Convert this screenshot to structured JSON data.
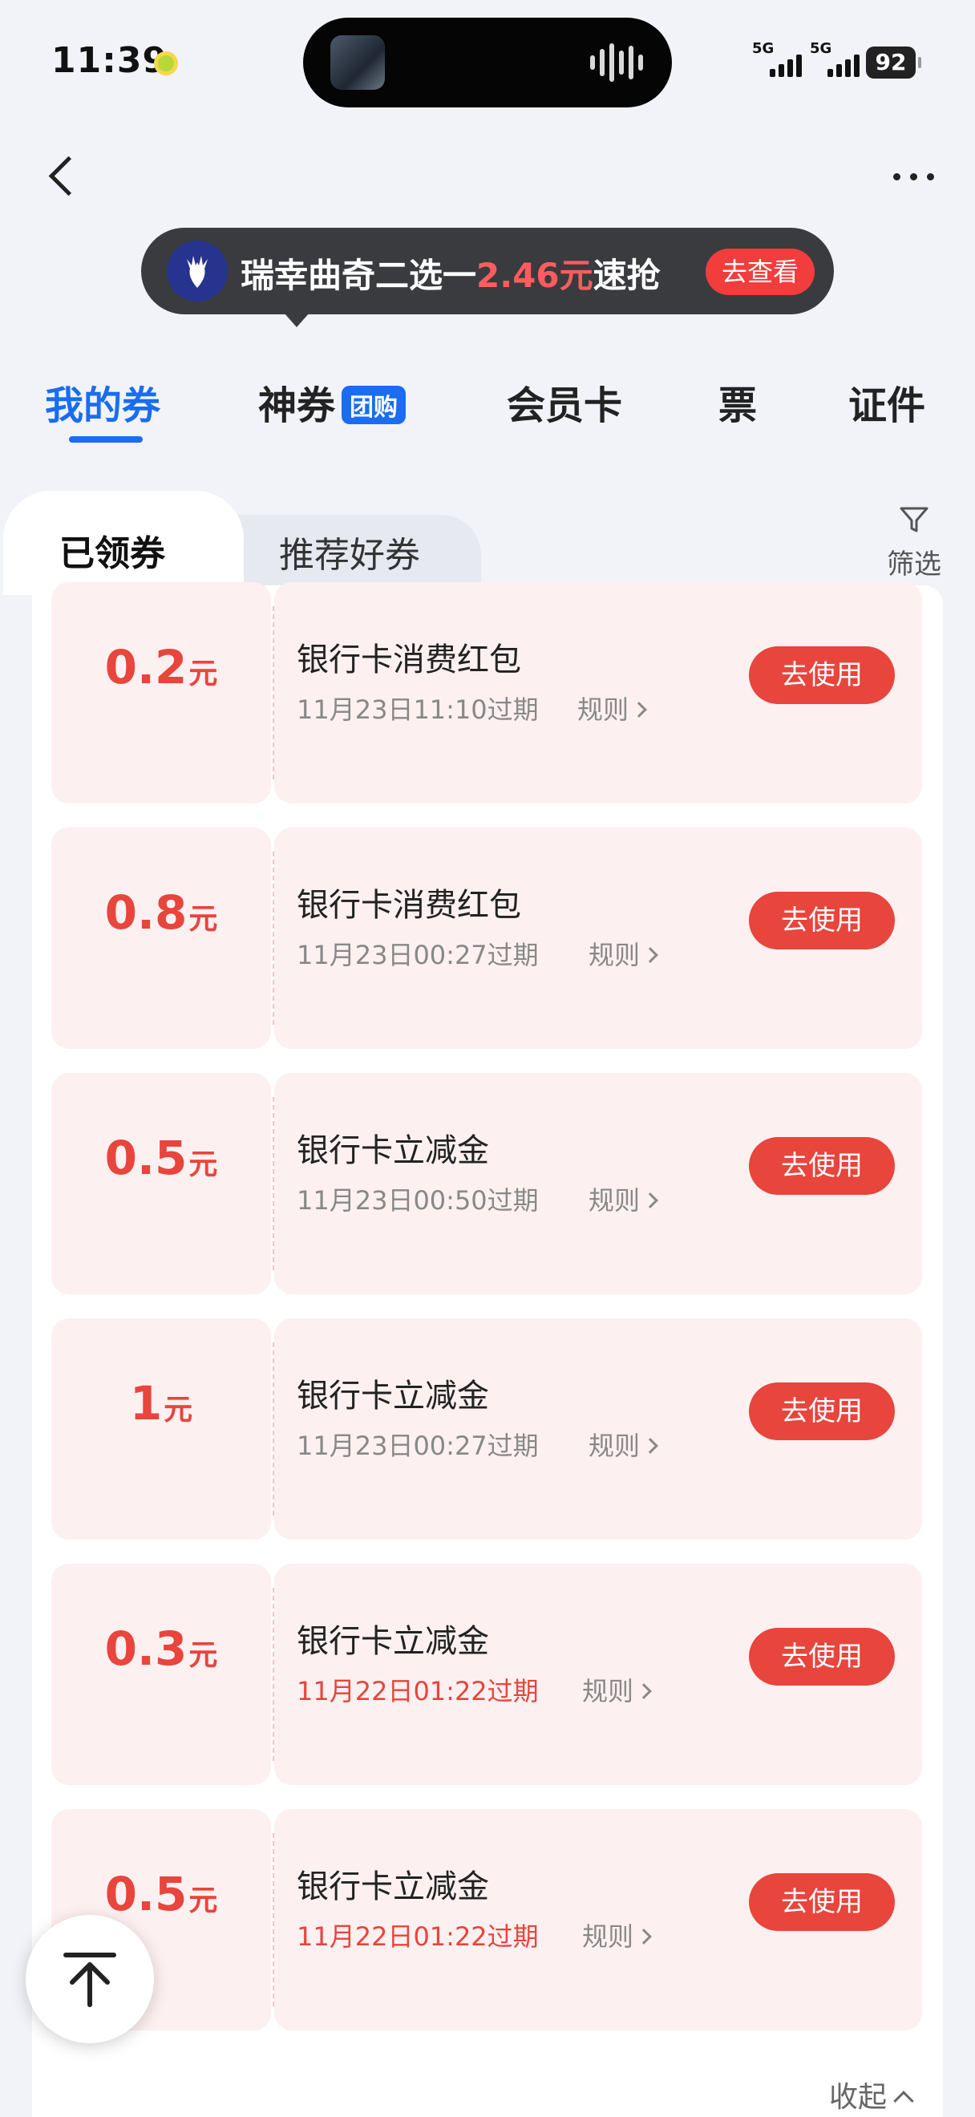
{
  "status": {
    "time": "11:39",
    "network_left": "5G",
    "network_right": "5G",
    "battery": "92"
  },
  "promo": {
    "text_before": "瑞幸曲奇二选一",
    "price": "2.46元",
    "text_after": "速抢",
    "button": "去查看"
  },
  "tabs": [
    {
      "label": "我的券",
      "active": true
    },
    {
      "label": "神券",
      "badge": "团购"
    },
    {
      "label": "会员卡"
    },
    {
      "label": "票"
    },
    {
      "label": "证件"
    }
  ],
  "subtabs": {
    "active": "已领券",
    "inactive": "推荐好券"
  },
  "filter_label": "筛选",
  "coupons": [
    {
      "amount": "0.2",
      "unit": "元",
      "title": "银行卡消费红包",
      "expiry": "11月23日11:10过期",
      "rules": "规则",
      "button": "去使用"
    },
    {
      "amount": "0.8",
      "unit": "元",
      "title": "银行卡消费红包",
      "expiry": "11月23日00:27过期",
      "rules": "规则",
      "button": "去使用"
    },
    {
      "amount": "0.5",
      "unit": "元",
      "title": "银行卡立减金",
      "expiry": "11月23日00:50过期",
      "rules": "规则",
      "button": "去使用"
    },
    {
      "amount": "1",
      "unit": "元",
      "title": "银行卡立减金",
      "expiry": "11月23日00:27过期",
      "rules": "规则",
      "button": "去使用"
    },
    {
      "amount": "0.3",
      "unit": "元",
      "title": "银行卡立减金",
      "expiry": "11月22日01:22过期",
      "rules": "规则",
      "button": "去使用",
      "urgent": true
    },
    {
      "amount": "0.5",
      "unit": "元",
      "title": "银行卡立减金",
      "expiry": "11月22日01:22过期",
      "rules": "规则",
      "button": "去使用",
      "urgent": true
    }
  ],
  "collapse_label": "收起",
  "colors": {
    "accent_blue": "#1a6cf0",
    "coupon_red": "#e8453c",
    "coupon_bg": "#fdf0f1"
  }
}
